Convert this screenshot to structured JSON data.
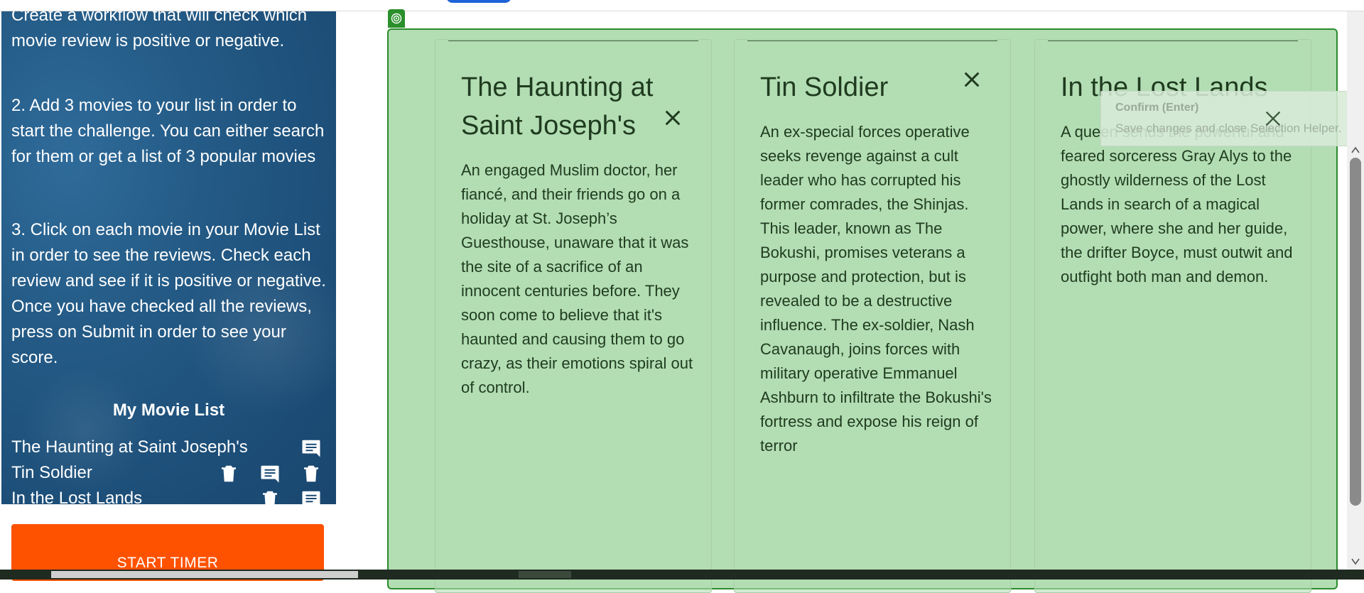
{
  "instructions": {
    "step1_tail": "Create a workflow that will check which movie review is positive or negative.",
    "step2": "2. Add 3 movies to your list in order to start the challenge. You can either search for them or get a list of 3 popular movies",
    "step3": "3. Click on each movie in your Movie List in order to see the reviews. Check each review and see if it is positive or negative. Once you have checked all the reviews, press on Submit in order to see your score."
  },
  "movie_list": {
    "title": "My Movie List",
    "items": [
      {
        "label": "The Haunting at Saint Joseph's"
      },
      {
        "label": "Tin Soldier"
      },
      {
        "label": "In the Lost Lands"
      }
    ]
  },
  "start_button": {
    "label": "START TIMER"
  },
  "cards": [
    {
      "title": "The Haunting at Saint Joseph's",
      "description": "An engaged Muslim doctor, her fiancé, and their friends go on a holiday at St. Joseph’s Guesthouse, unaware that it was the site of a sacrifice of an innocent centuries before. They soon come to believe that it's haunted and causing them to go crazy, as their emotions spiral out of control."
    },
    {
      "title": "Tin Soldier",
      "description": "An ex-special forces operative seeks revenge against a cult leader who has corrupted his former comrades, the Shinjas. This leader, known as The Bokushi, promises veterans a purpose and protection, but is revealed to be a destructive influence. The ex-soldier, Nash Cavanaugh, joins forces with military operative Emmanuel Ashburn to infiltrate the Bokushi's fortress and expose his reign of terror"
    },
    {
      "title": "In the Lost Lands",
      "description": "A queen sends the powerful and feared sorceress Gray Alys to the ghostly wilderness of the Lost Lands in search of a magical power, where she and her guide, the drifter Boyce, must outwit and outfight both man and demon."
    }
  ],
  "confirm_tooltip": {
    "title": "Confirm (Enter)",
    "subtitle": "Save changes and close Selection Helper."
  },
  "colors": {
    "accent_orange": "#ff5200",
    "selection_green": "#b3ddb3",
    "selection_border": "#2a8b2a",
    "sidebar_blue": "#245b86"
  },
  "icons": {
    "review": "comment-icon",
    "delete": "trash-icon",
    "close": "close-icon",
    "selection": "target-icon"
  }
}
